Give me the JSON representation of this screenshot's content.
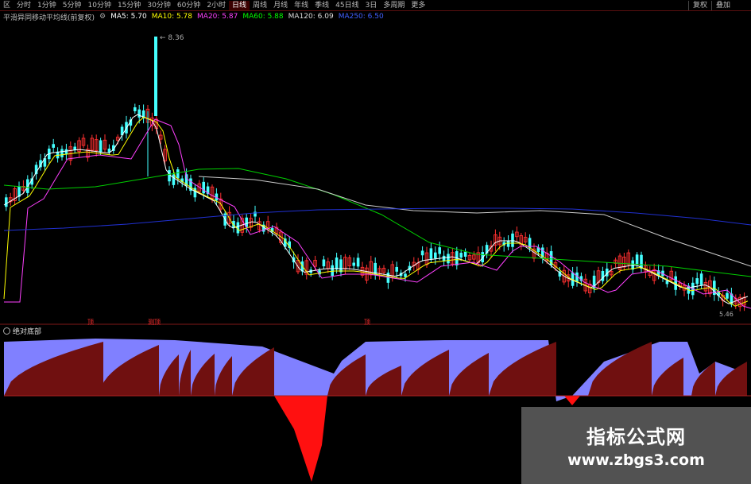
{
  "toolbar": {
    "tabs": [
      "区",
      "分时",
      "1分钟",
      "5分钟",
      "10分钟",
      "15分钟",
      "30分钟",
      "60分钟",
      "2小时",
      "日线",
      "周线",
      "月线",
      "年线",
      "季线",
      "45日线",
      "3日",
      "多周期",
      "更多"
    ],
    "active_index": 9,
    "right": [
      "复权",
      "叠加"
    ]
  },
  "ma": {
    "title": "平滑异同移动平均线(前复权)",
    "items": [
      {
        "label": "MA5: 5.70",
        "color": "#ffffff"
      },
      {
        "label": "MA10: 5.78",
        "color": "#ffff00"
      },
      {
        "label": "MA20: 5.87",
        "color": "#ff40ff"
      },
      {
        "label": "MA60: 5.88",
        "color": "#00ff00"
      },
      {
        "label": "MA120: 6.09",
        "color": "#dddddd"
      },
      {
        "label": "MA250: 6.50",
        "color": "#4060ff"
      }
    ]
  },
  "peak_label": "8.36",
  "low_label": "5.46",
  "indicator": {
    "title": "绝对底部"
  },
  "signals": [
    "顶",
    "测顶",
    "顶"
  ],
  "watermark": {
    "name": "指标公式网",
    "url": "www.zbgs3.com"
  },
  "colors": {
    "up": "#ff3030",
    "down": "#44ffff",
    "area_top": "#8080ff",
    "area_mid": "#701010",
    "area_red": "#ff1010"
  }
}
